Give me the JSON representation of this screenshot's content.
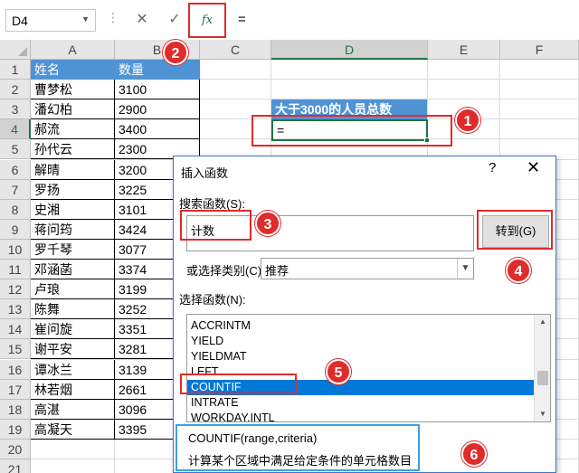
{
  "formula_bar": {
    "name_box": "D4",
    "cancel_icon": "✕",
    "confirm_icon": "✓",
    "fx_label": "fx",
    "formula": "="
  },
  "sheet": {
    "columns": [
      "A",
      "B",
      "C",
      "D",
      "E",
      "F"
    ],
    "rows": [
      "1",
      "2",
      "3",
      "4",
      "5",
      "6",
      "7",
      "8",
      "9",
      "10",
      "11",
      "12",
      "13",
      "14",
      "15",
      "16",
      "17",
      "18",
      "19",
      "20",
      "21"
    ],
    "header": {
      "name": "姓名",
      "qty": "数量"
    },
    "data": [
      {
        "name": "曹梦松",
        "qty": "3100"
      },
      {
        "name": "潘幻柏",
        "qty": "2900"
      },
      {
        "name": "郝流",
        "qty": "3400"
      },
      {
        "name": "孙代云",
        "qty": "2300"
      },
      {
        "name": "解晴",
        "qty": "3200"
      },
      {
        "name": "罗扬",
        "qty": "3225"
      },
      {
        "name": "史湘",
        "qty": "3101"
      },
      {
        "name": "蒋问筠",
        "qty": "3424"
      },
      {
        "name": "罗千琴",
        "qty": "3077"
      },
      {
        "name": "邓涵菡",
        "qty": "3374"
      },
      {
        "name": "卢琅",
        "qty": "3199"
      },
      {
        "name": "陈舞",
        "qty": "3252"
      },
      {
        "name": "崔问旋",
        "qty": "3351"
      },
      {
        "name": "谢平安",
        "qty": "3281"
      },
      {
        "name": "谭冰兰",
        "qty": "3139"
      },
      {
        "name": "林若烟",
        "qty": "2661"
      },
      {
        "name": "高湛",
        "qty": "3096"
      },
      {
        "name": "高凝天",
        "qty": "3395"
      }
    ],
    "d3_header": "大于3000的人员总数",
    "d4_value": "="
  },
  "dialog": {
    "title": "插入函数",
    "help": "?",
    "close": "✕",
    "search_label": "搜索函数(S):",
    "search_value": "计数",
    "go_button": "转到(G)",
    "category_label": "或选择类别(C):",
    "category_value": "推荐",
    "select_label": "选择函数(N):",
    "functions": [
      "ACCRINTM",
      "YIELD",
      "YIELDMAT",
      "LEFT",
      "COUNTIF",
      "INTRATE",
      "WORKDAY.INTL"
    ],
    "selected_function": "COUNTIF",
    "signature": "COUNTIF(range,criteria)",
    "description": "计算某个区域中满足给定条件的单元格数目"
  },
  "annotations": [
    "1",
    "2",
    "3",
    "4",
    "5",
    "6"
  ],
  "colors": {
    "header_fill": "#4f93d5",
    "selection": "#217346",
    "annotation": "#e02b2b",
    "list_selected": "#0078d7",
    "desc_border": "#3ea0df"
  }
}
